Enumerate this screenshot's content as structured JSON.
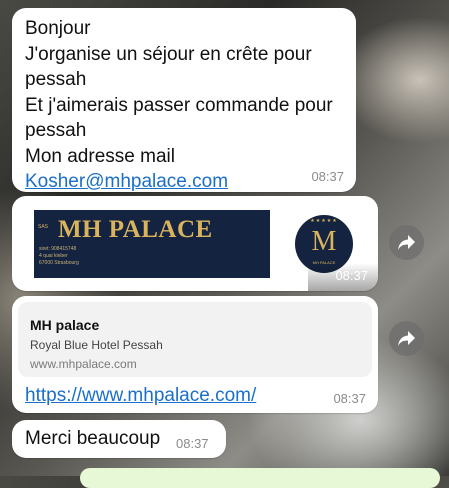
{
  "messages": {
    "m1": {
      "lines": [
        "Bonjour",
        "J'organise un séjour en crête pour",
        "pessah",
        "Et j'aimerais passer commande pour",
        "pessah",
        "Mon adresse mail"
      ],
      "email": "Kosher@mhpalace.com",
      "time": "08:37"
    },
    "m2": {
      "banner": {
        "sas": "SAS",
        "brand": "MH PALACE",
        "siret": "siret: 908415748",
        "street": "4 quai kleber",
        "city": "67000 Strasbourg"
      },
      "logo": {
        "stars": "★★★★★",
        "monogram": "M",
        "caption": "MH PALACE"
      },
      "time": "08:37"
    },
    "m3": {
      "preview_title": "MH palace",
      "preview_desc": "Royal Blue Hotel Pessah",
      "preview_url": "www.mhpalace.com",
      "link": "https://www.mhpalace.com/",
      "time": "08:37"
    },
    "m4": {
      "text": "Merci beaucoup",
      "time": "08:37"
    }
  },
  "icons": {
    "forward": "forward-icon"
  },
  "colors": {
    "link": "#1a6fc9",
    "bubble": "#ffffff",
    "brand_navy": "#14233f",
    "brand_gold": "#d9b45c"
  }
}
